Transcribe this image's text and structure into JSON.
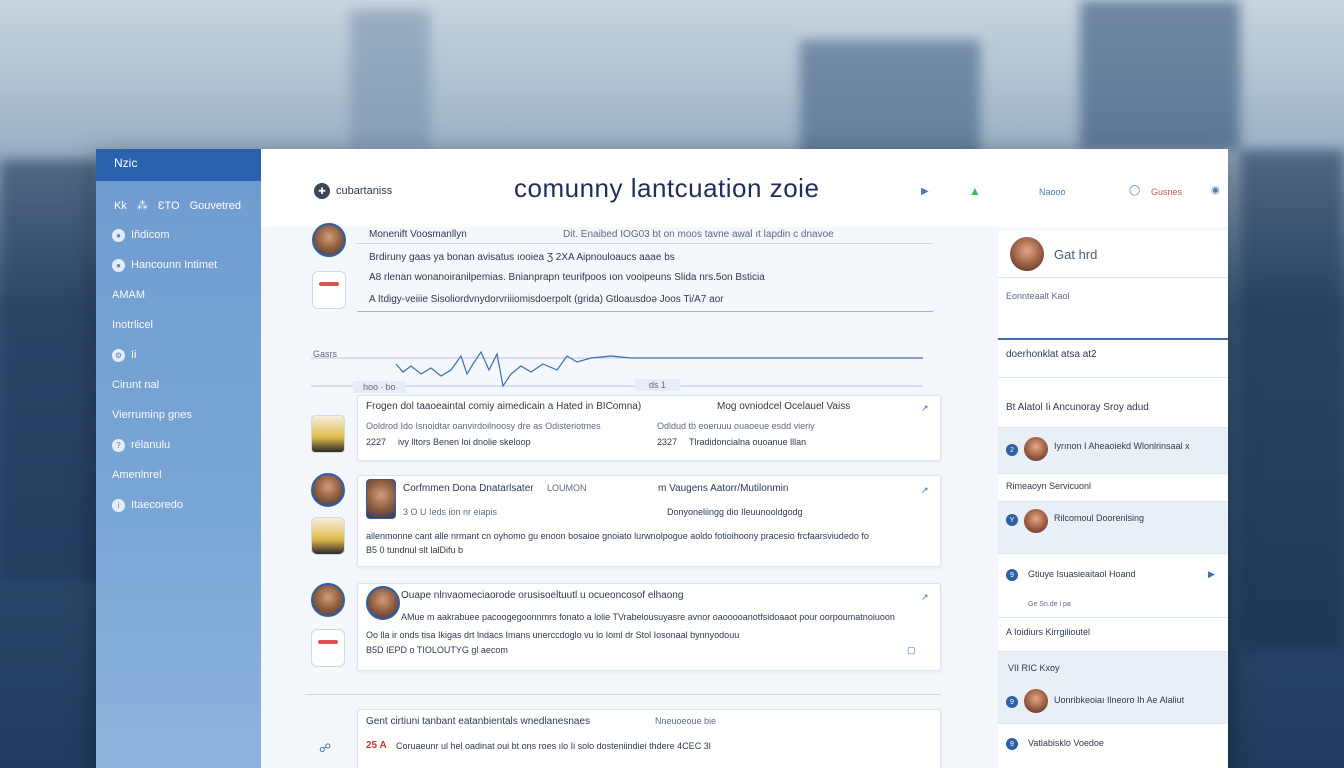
{
  "sidebar": {
    "header": "Nzic",
    "top_items": [
      "Kk",
      "⁂",
      "ƐTO",
      "Gouvetred"
    ],
    "items": [
      {
        "icon": "user-icon",
        "label": "Iñdicom"
      },
      {
        "icon": "people-icon",
        "label": "Hancounn Intimet"
      },
      {
        "icon": "",
        "label": "AMAM"
      },
      {
        "icon": "",
        "label": "Inotrlicel"
      },
      {
        "icon": "settings-icon",
        "label": "Ii"
      },
      {
        "icon": "",
        "label": "Cirunt nal"
      },
      {
        "icon": "",
        "label": "Vierruminp gnes"
      },
      {
        "icon": "help-icon",
        "label": "rélanulu"
      },
      {
        "icon": "",
        "label": "Amenlnrel"
      },
      {
        "icon": "info-icon",
        "label": "Itaecoredo"
      }
    ]
  },
  "header": {
    "brand": "cubartaniss",
    "title": "comunny lantcuation zoie",
    "right_labels": [
      "Naooo",
      "Gusnes"
    ]
  },
  "posts": [
    {
      "author": "Monenift Voosmanllyn",
      "meta": "Dit. Enaibed IOG03 bt on moos tavne awal ıt lapdin c dnavoe",
      "line1": "Brdiruny gaas ya bonan avisatus ıooiea  Ʒ  2XA  Aipnouloaucs aaae bs",
      "line2": "A8 rlenan wonanoiranilpemias. Bnianprapn teurifpoos ıon vooipeuns  Slida nrs.5on Bsticia",
      "line3": "A  Itdigy-veiiie Sisoliordvnydorvriiiomisdoerpolt (grida)  Gtloausdoə Joos Ti/A7 aor"
    },
    {
      "author": "Frogen dol taaoeaintal comiy aimedicain a Hated in  BIComna)",
      "right": "Mog ovniodcel Ocelauel Vaiss",
      "line1": "Ooldrod Ido Isnoidtar oanvirdoilnoosy dre as Odisteriotmes",
      "line2": "Odldud tb eoeruuu ouaoeue esdd vieriy",
      "num1": "2227",
      "line3": "ivy lltors Benen loi dnolie skeloop",
      "num2": "2327",
      "line4": "Tlradidoncialna ouoanue lllan"
    },
    {
      "author": "Corfmmen Dona Dnatarlsater",
      "tag": "LOUMON",
      "sub": "3 O U  Ieds ion nr eiapis",
      "right": "m Vaugens Aatorr/Mutilonmin",
      "right2": "Donyoneliingg dio Ileuunooldgodg",
      "line1": "ailenmonne cant alle nrmant cn oyhomo gu enoon bosaioe gnoiato lurwnolpogue aoldo fotioihoony pracesio frcfaarsviudedo fo",
      "line2": "B5 0 tundnul slt lalDifu  b"
    },
    {
      "author": "Ouape nlnvaomeciaorode orusisoeltuutl u ocueoncosof elhaong",
      "line1": "AMue m aakrabuee pacoogegoonnmrs fonato a lolie TVrabelousuyasre avnor oaooooanotfsidoaaot pour oorpoumatnoiuoon",
      "line2": "Oo lla ir onds tisa Ikigas drt lndacs Imans unerccdoglo vu lo Ioml dr Stol Iosonaal bynnyodouu",
      "line3": "B5D  IEPD o TIOLOUTYG gl aecom"
    },
    {
      "author": "Gent cirtiuni tanbant eatanbientals wnedlanesnaes",
      "num": "25 A",
      "line1": "Coruaeunr ul hel oadinat oui bt ons roes ılo Ii solo dosteniindiei thdere 4CEC 3l",
      "meta": "Nneuoeoue bie"
    }
  ],
  "chart": {
    "labels": [
      "Gasrs"
    ],
    "marker1": "hoo   ∙ bo",
    "marker2": "ds  1"
  },
  "right_panel": {
    "profile_label": "Gat hrd",
    "note": "Eonnteaalt Kaol",
    "section1": "doerhonklat atsa  at2",
    "section2": "Bt Alatol Ii Ancunoray Sroy adud",
    "items": [
      {
        "num": "2",
        "text": "Iyrınon I Aheaoiekd Wlonlrinsaal  x"
      },
      {
        "text": "Rimeaoyn   Servicuonl"
      },
      {
        "num": "Y",
        "text": "Rilcomoul Doorenlsing"
      },
      {
        "num": "9",
        "text": "Gtiuye Isuasieaitaol Hoand"
      },
      {
        "text": "Ge Sn.de  i pa"
      },
      {
        "text": "A Ioidiurs Kirrgilioutel"
      },
      {
        "text": "VII   RIC Kxoy"
      },
      {
        "num": "9",
        "text": "Uonribkeoiaı Ilneoro Ih Ae Alaliut"
      },
      {
        "num": "9",
        "text": "Vatlabisklo Voedoe"
      }
    ]
  }
}
